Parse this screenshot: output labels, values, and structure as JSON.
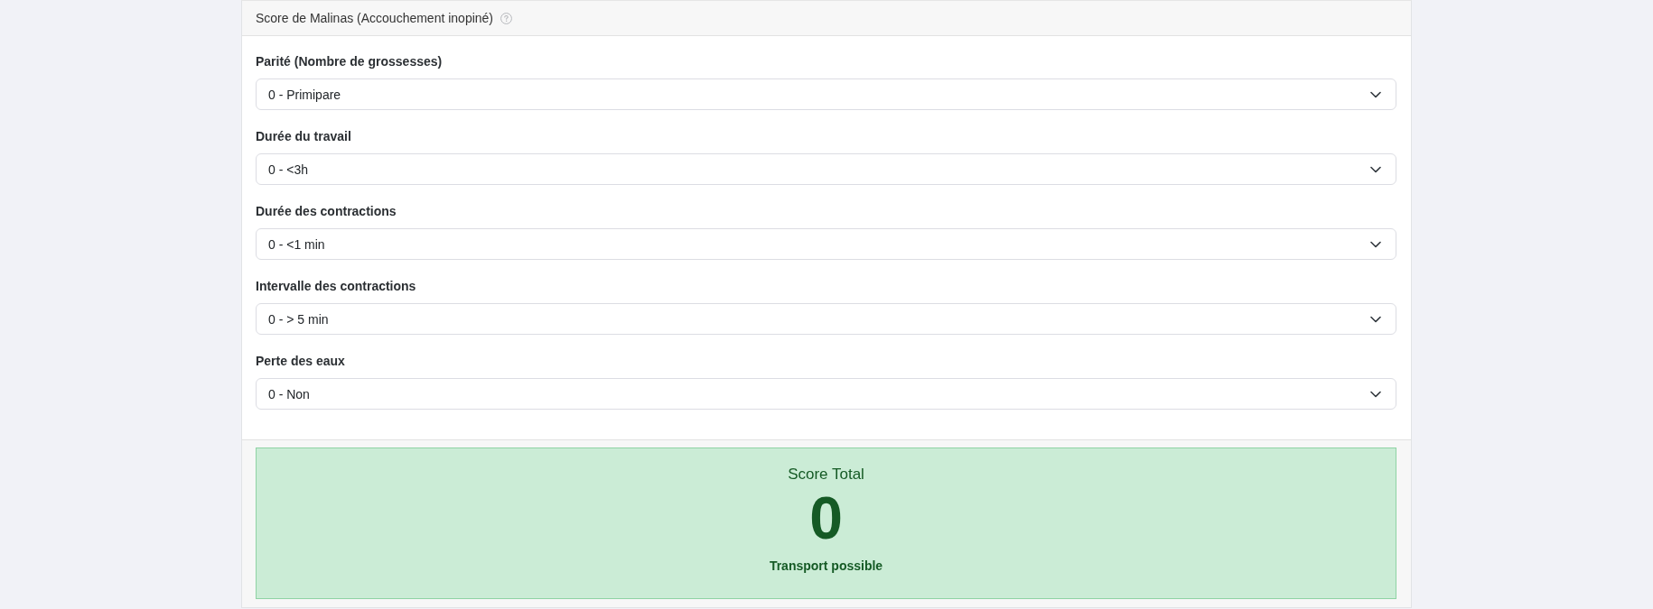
{
  "card": {
    "title": "Score de Malinas (Accouchement inopiné)"
  },
  "fields": [
    {
      "label": "Parité (Nombre de grossesses)",
      "value": "0 - Primipare"
    },
    {
      "label": "Durée du travail",
      "value": "0 - <3h"
    },
    {
      "label": "Durée des contractions",
      "value": "0 - <1 min"
    },
    {
      "label": "Intervalle des contractions",
      "value": "0 - > 5 min"
    },
    {
      "label": "Perte des eaux",
      "value": "0 - Non"
    }
  ],
  "result": {
    "kind": "success",
    "title": "Score Total",
    "score": "0",
    "verdict": "Transport possible"
  }
}
